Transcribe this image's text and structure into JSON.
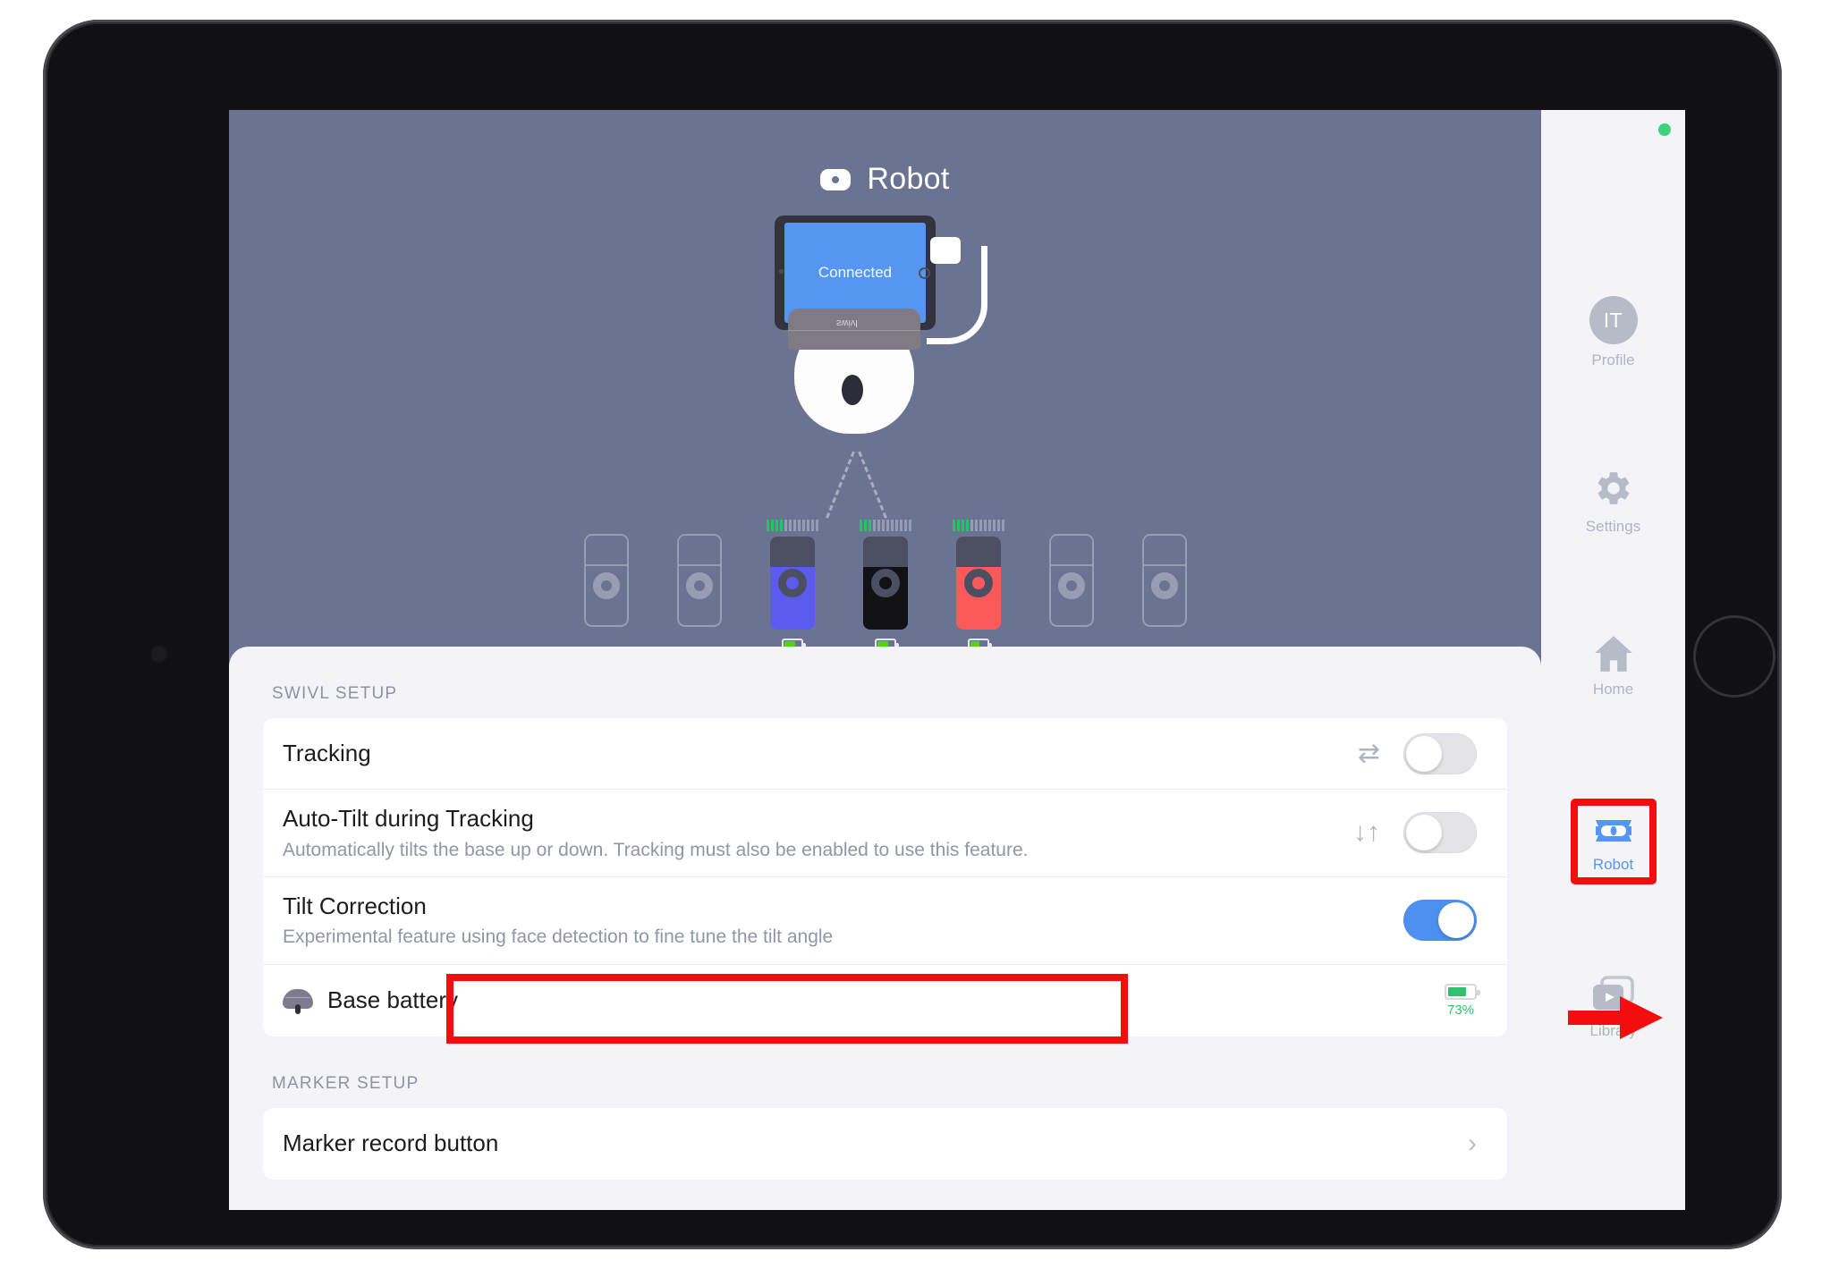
{
  "stage": {
    "title": "Robot",
    "title_icon": "robot-icon",
    "tablet_status": "Connected",
    "robot_brand": "swivl",
    "markers": [
      {
        "state": "empty",
        "color": null,
        "signal": null,
        "battery": null
      },
      {
        "state": "empty",
        "color": null,
        "signal": null,
        "battery": null
      },
      {
        "state": "active",
        "color": "#5b5bf0",
        "signal": 4,
        "battery": "72%"
      },
      {
        "state": "active",
        "color": "#111116",
        "signal": 3,
        "battery": "68%"
      },
      {
        "state": "active",
        "color": "#fc5a5a",
        "signal": 4,
        "battery": "60%"
      },
      {
        "state": "empty",
        "color": null,
        "signal": null,
        "battery": null
      },
      {
        "state": "empty",
        "color": null,
        "signal": null,
        "battery": null
      }
    ]
  },
  "settings": {
    "swivl_section_label": "SWIVL SETUP",
    "marker_section_label": "MARKER SETUP",
    "rows": {
      "tracking": {
        "title": "Tracking",
        "subtitle": "",
        "icon": "swap-horizontal-icon",
        "icon_glyph": "⇄",
        "toggle": "off"
      },
      "auto_tilt": {
        "title": "Auto-Tilt during Tracking",
        "subtitle": "Automatically tilts the base up or down. Tracking must also be enabled to use this feature.",
        "icon": "arrows-up-down-icon",
        "icon_glyph": "↓↑",
        "toggle": "off"
      },
      "tilt_correction": {
        "title": "Tilt Correction",
        "subtitle": "Experimental feature using face detection to fine tune the tilt angle",
        "toggle": "on"
      },
      "base_battery": {
        "title": "Base battery",
        "icon": "robot-base-icon",
        "battery_percent": "73%",
        "battery_fill": 73
      },
      "marker_record_button": {
        "title": "Marker record button",
        "chevron": "chevron-right-icon"
      }
    }
  },
  "nav": {
    "status_dot_color": "#3ed37a",
    "items": [
      {
        "label": "Profile",
        "icon": "avatar-icon",
        "avatar_initials": "IT",
        "active": false
      },
      {
        "label": "Settings",
        "icon": "gear-icon",
        "active": false
      },
      {
        "label": "Home",
        "icon": "home-icon",
        "active": false
      },
      {
        "label": "Robot",
        "icon": "robot-icon",
        "active": true
      },
      {
        "label": "Library",
        "icon": "library-icon",
        "active": false
      }
    ]
  },
  "annotations": {
    "highlight_color": "#f40d0d",
    "boxes": [
      "tilt-correction-row",
      "nav-item-robot"
    ],
    "arrow": "points-to-tilt-correction-toggle"
  },
  "colors": {
    "stage_background": "#6a7391",
    "sheet_background": "#f4f4f8",
    "card_background": "#ffffff",
    "accent_blue": "#4e90f0",
    "battery_green": "#2ec26e"
  }
}
